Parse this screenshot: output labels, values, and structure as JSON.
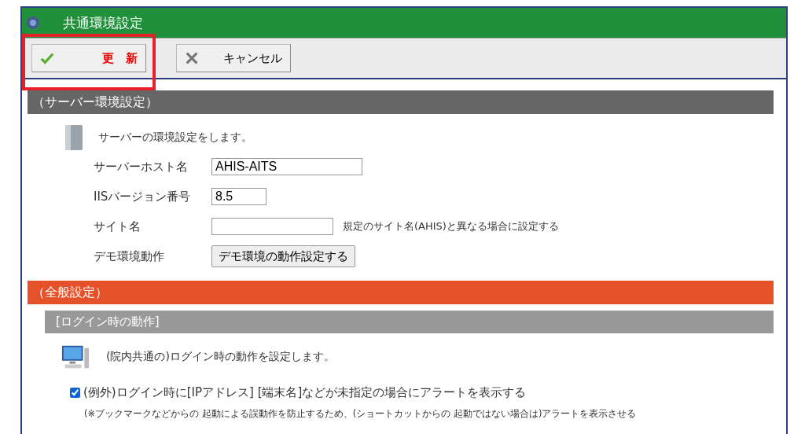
{
  "window": {
    "title": "共通環境設定"
  },
  "toolbar": {
    "buttons": [
      {
        "kind": "update",
        "label": "更　新",
        "highlighted": true
      },
      {
        "kind": "cancel",
        "label": "キャンセル",
        "highlighted": false
      }
    ]
  },
  "server_section": {
    "title": "（サーバー環境設定）",
    "description": "サーバーの環境設定をします。",
    "fields": [
      {
        "kind": "input",
        "label": "サーバーホスト名",
        "value": "AHIS-AITS"
      },
      {
        "kind": "input",
        "label": "IISバージョン番号",
        "value": "8.5"
      },
      {
        "kind": "input",
        "label": "サイト名",
        "note": "規定のサイト名(AHIS)と異なる場合に設定する"
      },
      {
        "kind": "button",
        "label": "デモ環境動作",
        "button": "デモ環境の動作設定する"
      }
    ]
  },
  "general_section": {
    "title": "（全般設定）",
    "subsections": [
      {
        "title": "[ログイン時の動作]",
        "description": "(院内共通の)ログイン時の動作を設定します。",
        "options": [
          {
            "label": "(例外)ログイン時に[IPアドレス] [端末名]などが未指定の場合にアラートを表示する",
            "checked": true,
            "note": "(※ブックマークなどからの 起動による誤動作を防止するため、(ショートカットからの 起動ではない場合は)アラートを表示させる"
          }
        ]
      }
    ]
  }
}
